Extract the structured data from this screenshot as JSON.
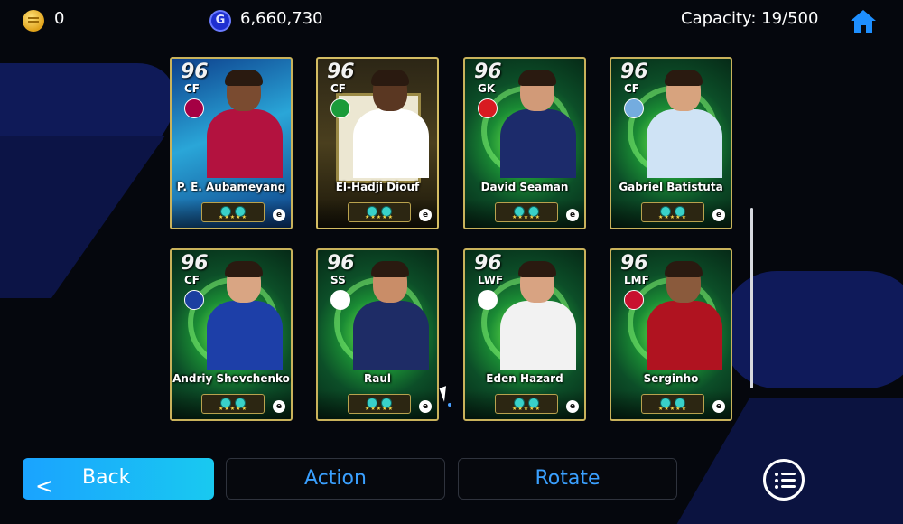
{
  "topbar": {
    "coins": "0",
    "gp": "6,660,730",
    "gp_icon_letter": "G",
    "capacity": "Capacity: 19/500"
  },
  "cards": [
    {
      "rating": "96",
      "position": "CF",
      "name": "P. E. Aubameyang",
      "theme": "blue",
      "club_color": "#a50044",
      "kit": "#b3123f",
      "skin": "#7a4b30"
    },
    {
      "rating": "96",
      "position": "CF",
      "name": "El-Hadji Diouf",
      "theme": "gold",
      "club_color": "#1a9b3a",
      "kit": "#ffffff",
      "skin": "#5a3722"
    },
    {
      "rating": "96",
      "position": "GK",
      "name": "David Seaman",
      "theme": "green",
      "club_color": "#d81b21",
      "kit": "#1c2b6b",
      "skin": "#d19a78"
    },
    {
      "rating": "96",
      "position": "CF",
      "name": "Gabriel Batistuta",
      "theme": "green",
      "club_color": "#74acdf",
      "kit": "#cfe3f5",
      "skin": "#d7a37e"
    },
    {
      "rating": "96",
      "position": "CF",
      "name": "Andriy Shevchenko",
      "theme": "green",
      "club_color": "#1b3fa0",
      "kit": "#1d3fa8",
      "skin": "#d9a583"
    },
    {
      "rating": "96",
      "position": "SS",
      "name": "Raul",
      "theme": "green",
      "club_color": "#ffffff",
      "kit": "#1e2c66",
      "skin": "#c98d68"
    },
    {
      "rating": "96",
      "position": "LWF",
      "name": "Eden Hazard",
      "theme": "green",
      "club_color": "#ffffff",
      "kit": "#f2f2f2",
      "skin": "#d8a382"
    },
    {
      "rating": "96",
      "position": "LMF",
      "name": "Serginho",
      "theme": "green",
      "club_color": "#c8102e",
      "kit": "#b01320",
      "skin": "#8a5a3c"
    }
  ],
  "buttons": {
    "back": "Back",
    "back_chevron": "<",
    "action": "Action",
    "rotate": "Rotate"
  },
  "colors": {
    "accent": "#3aa0ff",
    "back_button": "#1aa3ff",
    "card_border": "#c9b25b"
  }
}
